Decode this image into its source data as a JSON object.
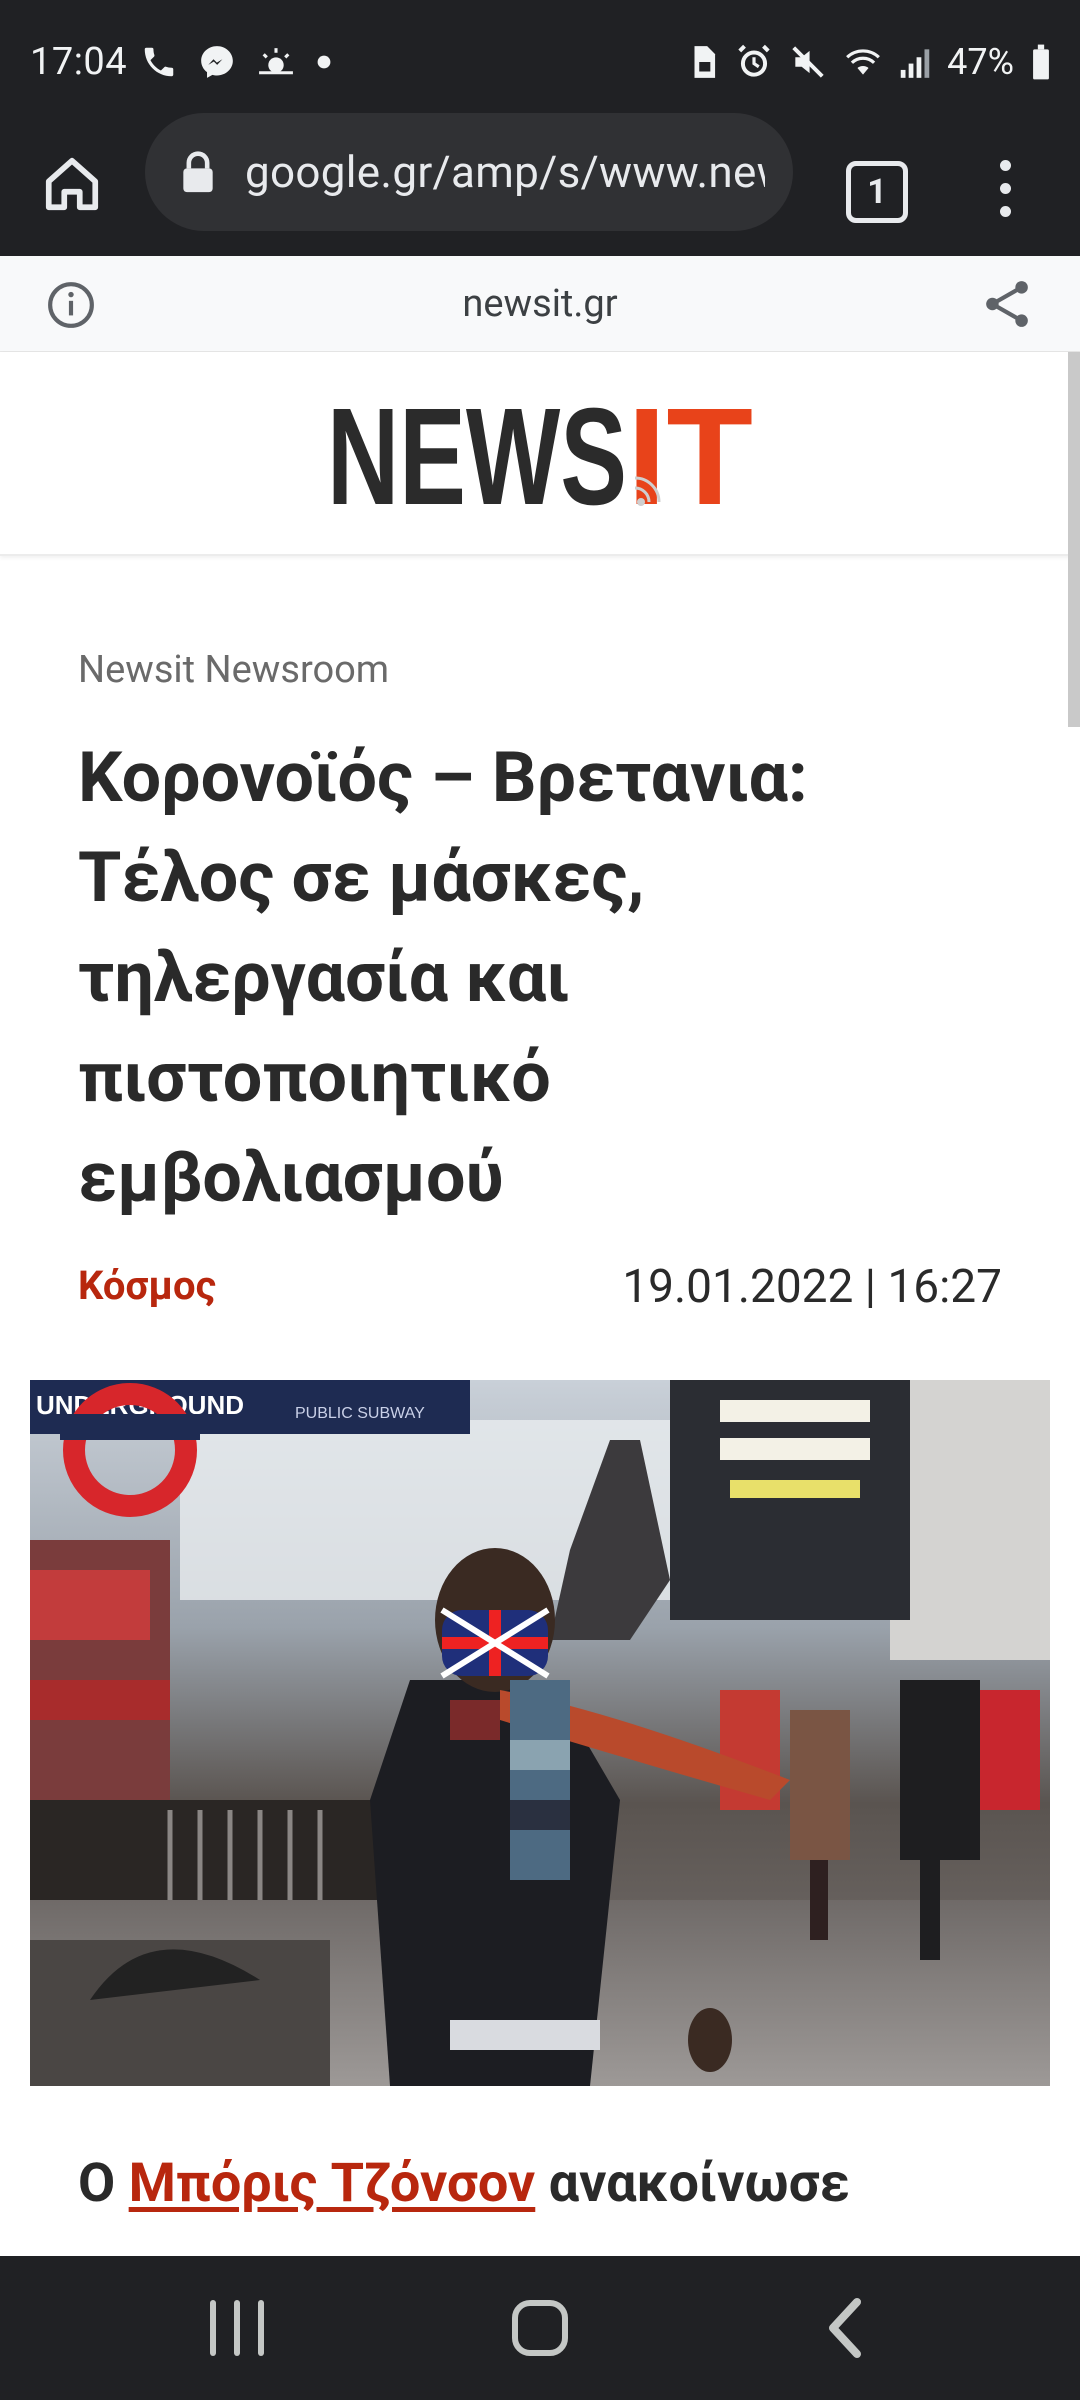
{
  "status_bar": {
    "time": "17:04",
    "battery": "47%",
    "left_icons": [
      "phone-icon",
      "messenger-icon",
      "weather-icon",
      "dot-icon"
    ],
    "right_icons": [
      "sim-lock-icon",
      "alarm-icon",
      "mute-icon",
      "wifi-icon",
      "signal-icon",
      "battery-icon"
    ]
  },
  "browser": {
    "url": "google.gr/amp/s/www.newsit.gr",
    "tab_count": "1"
  },
  "amp_bar": {
    "domain": "newsit.gr"
  },
  "site": {
    "logo_text_dark": "NEWS",
    "logo_text_accent": "IT",
    "brand_color": "#e8431a",
    "accent_text_color": "#b8270e"
  },
  "article": {
    "author": "Newsit Newsroom",
    "headline_lines": [
      "Κορονοϊός – Βρετανια:",
      "Τέλος σε μάσκες,",
      "τηλεργασία και",
      "πιστοποιητικό",
      "εμβολιασμού"
    ],
    "category": "Κόσμος",
    "date": "19.01.2022 | 16:27",
    "image_signs": [
      "UNDERGROUND",
      "PUBLIC SUBWAY"
    ],
    "body_prefix": "Ο ",
    "body_link": "Μπόρις Τζόνσον",
    "body_suffix": " ανακοίνωσε"
  }
}
